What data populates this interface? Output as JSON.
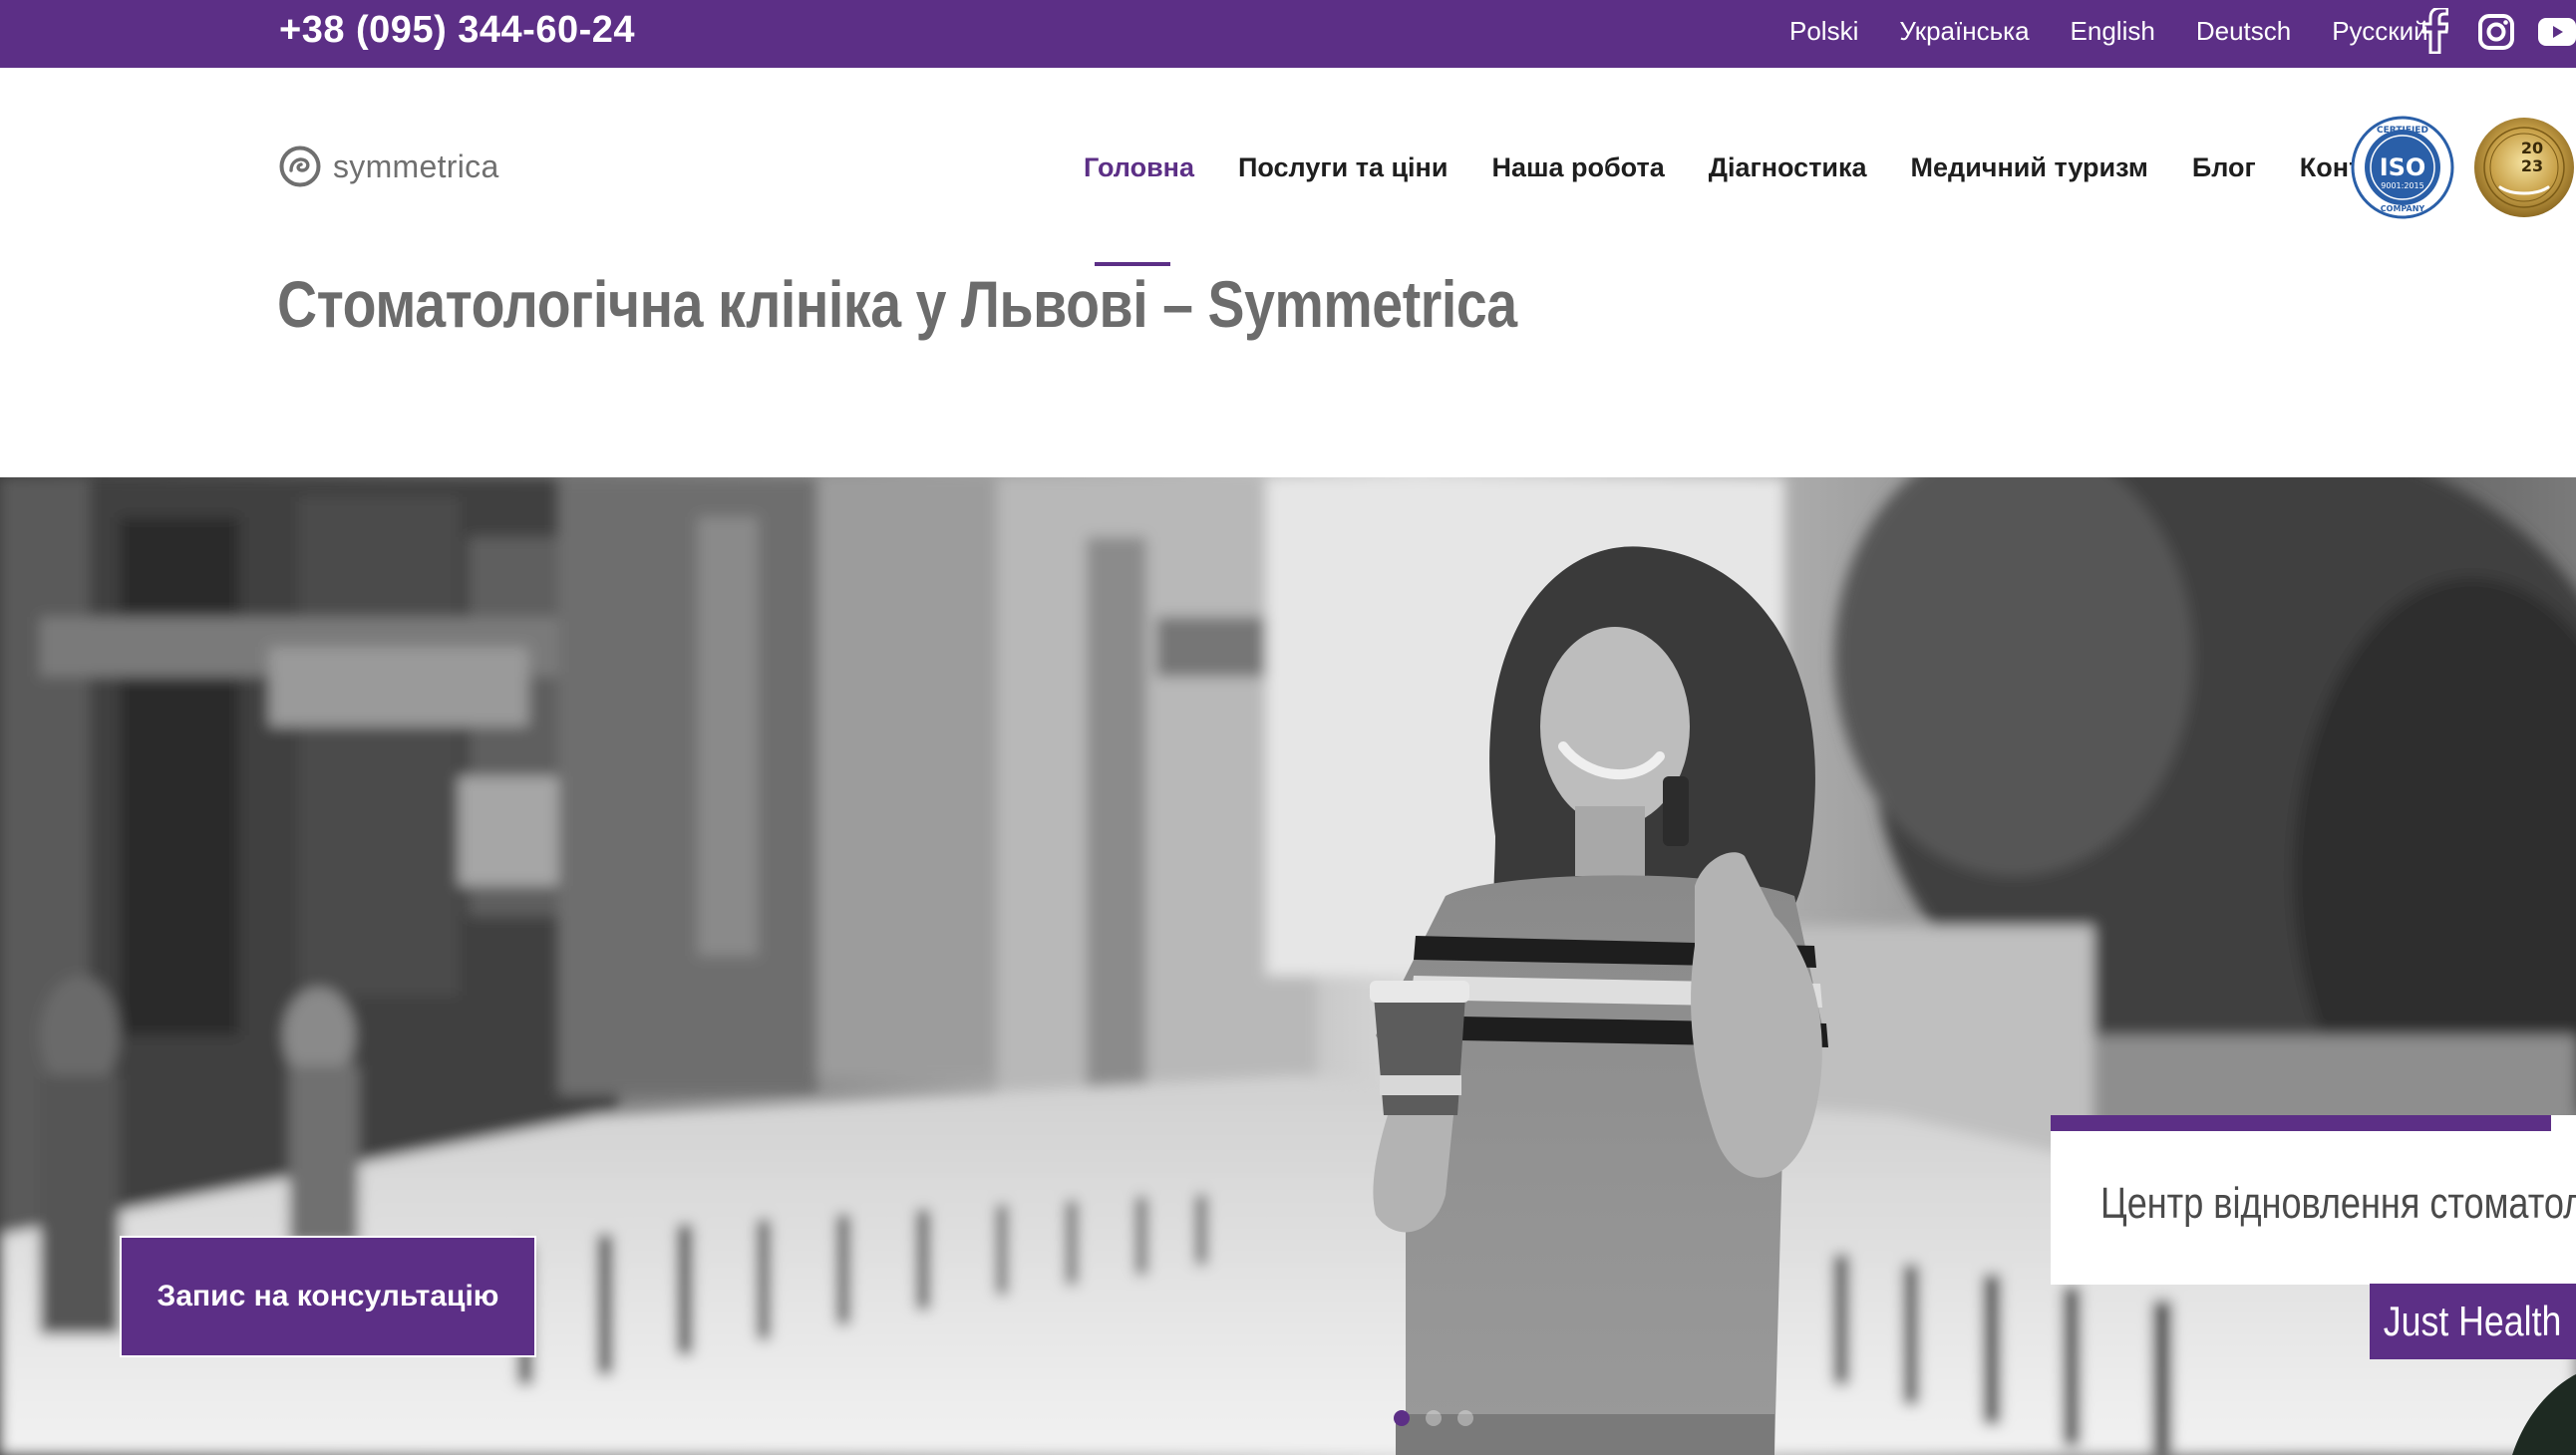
{
  "topbar": {
    "phone": "+38 (095) 344-60-24",
    "languages": [
      "Polski",
      "Українська",
      "English",
      "Deutsch",
      "Русский"
    ],
    "social_icons": [
      "facebook-icon",
      "instagram-icon",
      "youtube-icon"
    ],
    "bg_color": "#5c2f86"
  },
  "header": {
    "logo_text": "symmetrica",
    "nav": [
      "Головна",
      "Послуги та ціни",
      "Наша робота",
      "Діагностика",
      "Медичний туризм",
      "Блог",
      "Контакти"
    ],
    "active_nav": "Головна",
    "badges": {
      "iso": {
        "top": "CERTIFIED",
        "main": "ISO",
        "code": "9001:2015",
        "bottom": "COMPANY"
      },
      "gold": {
        "year_top": "20",
        "year_bottom": "23"
      }
    }
  },
  "page": {
    "title": "Стоматологічна клініка у Львові – Symmetrica"
  },
  "hero": {
    "cta_label": "Запис на консультацію",
    "card_text": "Центр відновлення стоматологі",
    "tagline": "Just Health",
    "slides_count": 3,
    "active_slide": 1
  },
  "colors": {
    "accent": "#5c2f86",
    "nav_text": "#1e1e1e",
    "title_text": "#6c6c6c"
  }
}
